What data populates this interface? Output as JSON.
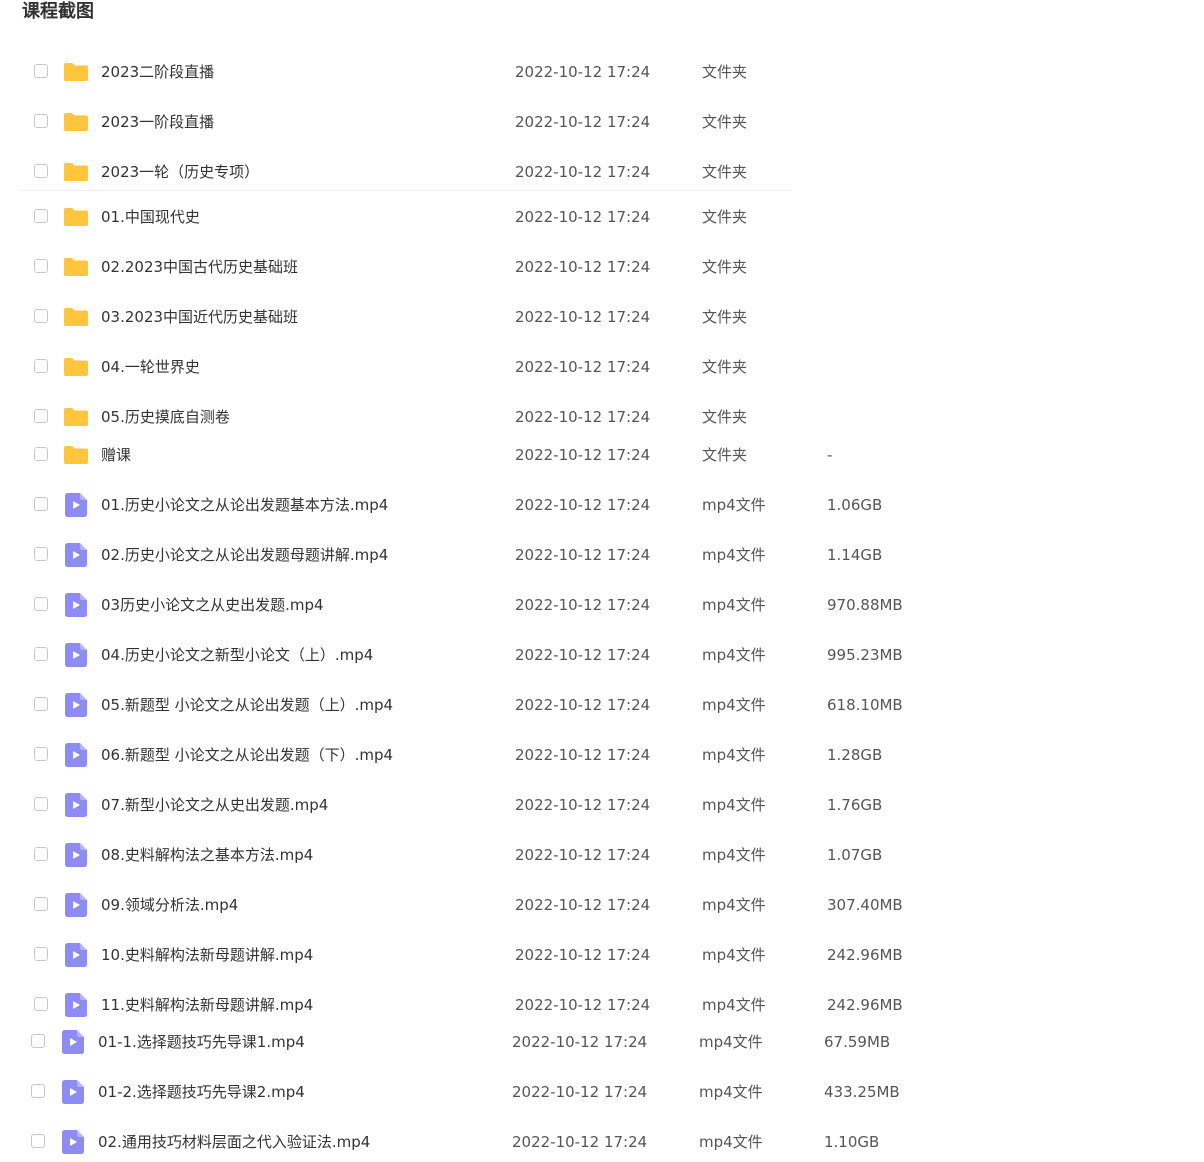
{
  "page_title": "课程截图",
  "files": [
    {
      "name": "2023二阶段直播",
      "date": "2022-10-12 17:24",
      "type": "文件夹",
      "size": "",
      "icon": "folder-icon"
    },
    {
      "name": "2023一阶段直播",
      "date": "2022-10-12 17:24",
      "type": "文件夹",
      "size": "",
      "icon": "folder-icon"
    },
    {
      "name": "2023一轮（历史专项）",
      "date": "2022-10-12 17:24",
      "type": "文件夹",
      "size": "",
      "icon": "folder-icon"
    },
    {
      "name": "01.中国现代史",
      "date": "2022-10-12 17:24",
      "type": "文件夹",
      "size": "",
      "icon": "folder-icon"
    },
    {
      "name": "02.2023中国古代历史基础班",
      "date": "2022-10-12 17:24",
      "type": "文件夹",
      "size": "",
      "icon": "folder-icon"
    },
    {
      "name": "03.2023中国近代历史基础班",
      "date": "2022-10-12 17:24",
      "type": "文件夹",
      "size": "",
      "icon": "folder-icon"
    },
    {
      "name": "04.一轮世界史",
      "date": "2022-10-12 17:24",
      "type": "文件夹",
      "size": "",
      "icon": "folder-icon"
    },
    {
      "name": "05.历史摸底自测卷",
      "date": "2022-10-12 17:24",
      "type": "文件夹",
      "size": "",
      "icon": "folder-icon"
    },
    {
      "name": "赠课",
      "date": "2022-10-12 17:24",
      "type": "文件夹",
      "size": "-",
      "icon": "folder-icon"
    },
    {
      "name": "01.历史小论文之从论出发题基本方法.mp4",
      "date": "2022-10-12 17:24",
      "type": "mp4文件",
      "size": "1.06GB",
      "icon": "video-file-icon"
    },
    {
      "name": "02.历史小论文之从论出发题母题讲解.mp4",
      "date": "2022-10-12 17:24",
      "type": "mp4文件",
      "size": "1.14GB",
      "icon": "video-file-icon"
    },
    {
      "name": "03历史小论文之从史出发题.mp4",
      "date": "2022-10-12 17:24",
      "type": "mp4文件",
      "size": "970.88MB",
      "icon": "video-file-icon"
    },
    {
      "name": "04.历史小论文之新型小论文（上）.mp4",
      "date": "2022-10-12 17:24",
      "type": "mp4文件",
      "size": "995.23MB",
      "icon": "video-file-icon"
    },
    {
      "name": "05.新题型 小论文之从论出发题（上）.mp4",
      "date": "2022-10-12 17:24",
      "type": "mp4文件",
      "size": "618.10MB",
      "icon": "video-file-icon"
    },
    {
      "name": "06.新题型 小论文之从论出发题（下）.mp4",
      "date": "2022-10-12 17:24",
      "type": "mp4文件",
      "size": "1.28GB",
      "icon": "video-file-icon"
    },
    {
      "name": "07.新型小论文之从史出发题.mp4",
      "date": "2022-10-12 17:24",
      "type": "mp4文件",
      "size": "1.76GB",
      "icon": "video-file-icon"
    },
    {
      "name": "08.史料解构法之基本方法.mp4",
      "date": "2022-10-12 17:24",
      "type": "mp4文件",
      "size": "1.07GB",
      "icon": "video-file-icon"
    },
    {
      "name": "09.领域分析法.mp4",
      "date": "2022-10-12 17:24",
      "type": "mp4文件",
      "size": "307.40MB",
      "icon": "video-file-icon"
    },
    {
      "name": "10.史料解构法新母题讲解.mp4",
      "date": "2022-10-12 17:24",
      "type": "mp4文件",
      "size": "242.96MB",
      "icon": "video-file-icon"
    },
    {
      "name": "11.史料解构法新母题讲解.mp4",
      "date": "2022-10-12 17:24",
      "type": "mp4文件",
      "size": "242.96MB",
      "icon": "video-file-icon"
    },
    {
      "name": "01-1.选择题技巧先导课1.mp4",
      "date": "2022-10-12 17:24",
      "type": "mp4文件",
      "size": "67.59MB",
      "icon": "video-file-icon"
    },
    {
      "name": "01-2.选择题技巧先导课2.mp4",
      "date": "2022-10-12 17:24",
      "type": "mp4文件",
      "size": "433.25MB",
      "icon": "video-file-icon"
    },
    {
      "name": "02.通用技巧材料层面之代入验证法.mp4",
      "date": "2022-10-12 17:24",
      "type": "mp4文件",
      "size": "1.10GB",
      "icon": "video-file-icon"
    }
  ],
  "colors": {
    "folder": "#ffc63d",
    "video": "#8c8cf2",
    "text": "#333333"
  }
}
